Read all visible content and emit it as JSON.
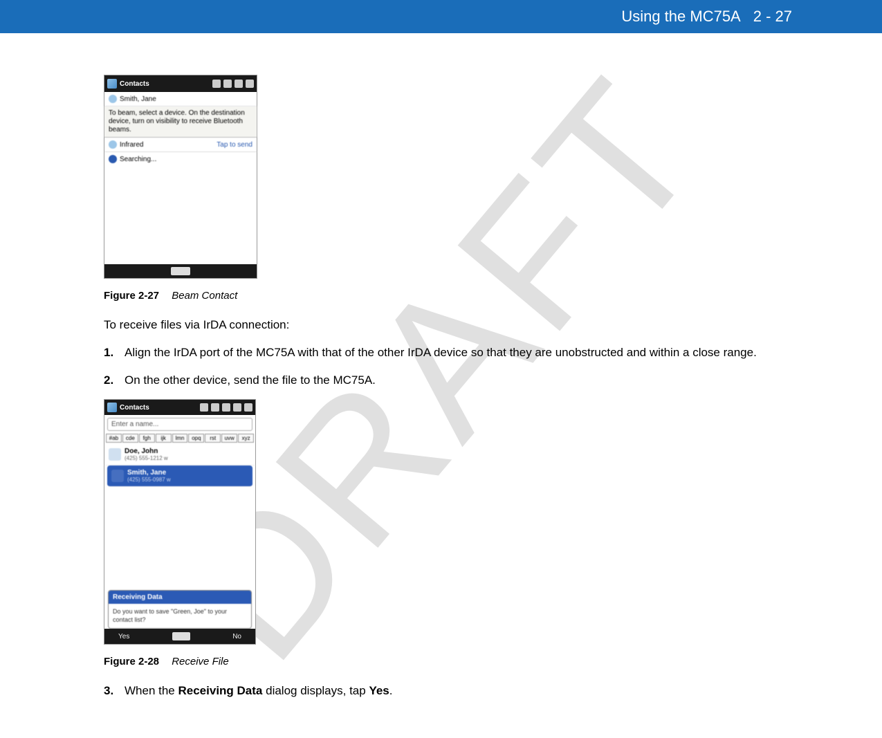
{
  "header": {
    "chapter": "Using the MC75A",
    "page": "2 - 27"
  },
  "watermark": "DRAFT",
  "screenshot1": {
    "title": "Contacts",
    "contact_name": "Smith, Jane",
    "instruction": "To beam, select a device. On the destination device, turn on visibility to receive Bluetooth beams.",
    "row_infrared": "Infrared",
    "row_infrared_action": "Tap to send",
    "row_searching": "Searching..."
  },
  "figure1": {
    "label": "Figure 2-27",
    "title": "Beam Contact"
  },
  "para_intro": "To receive files via IrDA connection:",
  "steps_a": {
    "1": "Align the IrDA port of the MC75A with that of the other IrDA device so that they are unobstructed and within a close range.",
    "2": "On the other device, send the file to the MC75A."
  },
  "screenshot2": {
    "title": "Contacts",
    "search_placeholder": "Enter a name...",
    "alpha": [
      "#ab",
      "cde",
      "fgh",
      "ijk",
      "lmn",
      "opq",
      "rst",
      "uvw",
      "xyz"
    ],
    "contact1_name": "Doe, John",
    "contact1_phone": "(425) 555-1212  w",
    "contact2_name": "Smith, Jane",
    "contact2_phone": "(425) 555-0987  w",
    "dialog_title": "Receiving Data",
    "dialog_body": "Do you want to save \"Green, Joe\" to your contact list?",
    "btn_yes": "Yes",
    "btn_no": "No"
  },
  "figure2": {
    "label": "Figure 2-28",
    "title": "Receive File"
  },
  "steps_b": {
    "3_pre": "When the ",
    "3_bold1": "Receiving Data",
    "3_mid": " dialog displays, tap ",
    "3_bold2": "Yes",
    "3_post": "."
  }
}
